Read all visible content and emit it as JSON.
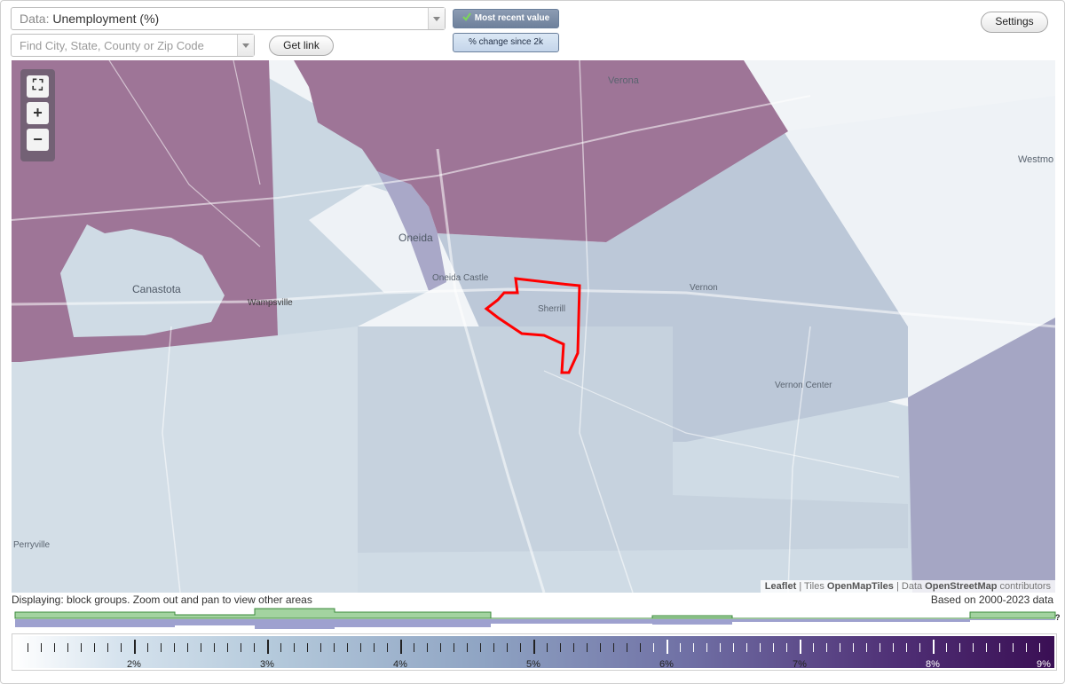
{
  "data_select": {
    "prefix": "Data:",
    "value": "Unemployment (%)"
  },
  "search": {
    "placeholder": "Find City, State, County or Zip Code"
  },
  "buttons": {
    "get_link": "Get link",
    "settings": "Settings",
    "most_recent": "Most recent value",
    "change_since": "% change since 2k"
  },
  "map": {
    "labels": {
      "verona": "Verona",
      "westmoreland": "Westmo",
      "oneida": "Oneida",
      "oneida_castle": "Oneida Castle",
      "canastota": "Canastota",
      "wampsville": "Wampsville",
      "sherrill": "Sherrill",
      "vernon": "Vernon",
      "vernon_center": "Vernon Center",
      "perryville": "Perryville"
    },
    "zoom": {
      "fit": "⛶",
      "in": "+",
      "out": "−"
    },
    "attribution": {
      "leaflet": "Leaflet",
      "sep1": " | Tiles ",
      "tiles": "OpenMapTiles",
      "sep2": " | Data ",
      "data": "OpenStreetMap",
      "contrib": " contributors"
    },
    "colors": {
      "high": "#9e7597",
      "mid": "#bac6d6",
      "low": "#cfdbe5",
      "lowest": "#eef2f6",
      "east": "#a5a6c4",
      "highlight": "#ff0000"
    }
  },
  "footer": {
    "displaying": "Displaying: block groups. Zoom out and pan to view other areas",
    "based_on": "Based on 2000-2023 data",
    "help": "?"
  },
  "legend": {
    "labels": [
      "2%",
      "3%",
      "4%",
      "5%",
      "6%",
      "7%",
      "8%",
      "9%"
    ],
    "range": [
      1.2,
      9.0
    ]
  }
}
